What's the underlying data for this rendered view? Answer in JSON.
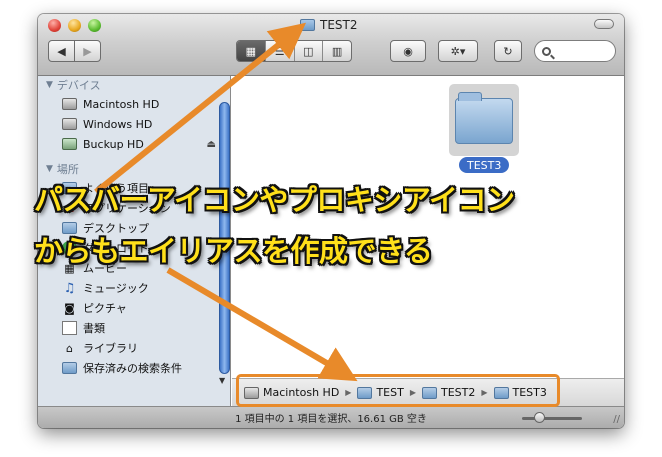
{
  "window": {
    "title": "TEST2"
  },
  "toolbar": {
    "back": "◀",
    "forward": "▶",
    "views": [
      "▦",
      "☰",
      "◫",
      "▥"
    ],
    "eye": "◉",
    "gear": "✲▾",
    "sync": "↻"
  },
  "sidebar": {
    "devices_header": "デバイス",
    "devices": [
      {
        "label": "Macintosh HD",
        "icon": "hard-drive-icon"
      },
      {
        "label": "Windows HD",
        "icon": "hard-drive-icon"
      },
      {
        "label": "Buckup HD",
        "icon": "external-drive-icon",
        "eject": "⏏"
      }
    ],
    "places_header": "場所",
    "places": [
      {
        "label": "よく使う項目",
        "icon": "favorites-folder-icon",
        "glyph": ""
      },
      {
        "label": "アプリケーション",
        "icon": "applications-icon",
        "glyph": "A"
      },
      {
        "label": "デスクトップ",
        "icon": "desktop-icon",
        "glyph": ""
      },
      {
        "label": "ダウンロード",
        "icon": "downloads-icon",
        "glyph": "↓"
      },
      {
        "label": "ムービー",
        "icon": "movies-icon",
        "glyph": "▦"
      },
      {
        "label": "ミュージック",
        "icon": "music-icon",
        "glyph": "♫"
      },
      {
        "label": "ピクチャ",
        "icon": "pictures-icon",
        "glyph": "◙"
      },
      {
        "label": "書類",
        "icon": "documents-icon",
        "glyph": ""
      },
      {
        "label": "ライブラリ",
        "icon": "library-icon",
        "glyph": "⌂"
      },
      {
        "label": "保存済みの検索条件",
        "icon": "smart-folder-icon",
        "glyph": ""
      }
    ]
  },
  "content": {
    "items": [
      {
        "label": "TEST3",
        "selected": true
      }
    ]
  },
  "pathbar": {
    "segments": [
      "Macintosh HD",
      "TEST",
      "TEST2",
      "TEST3"
    ],
    "separator": "▶"
  },
  "status": {
    "text": "1 項目中の 1 項目を選択、16.61 GB 空き",
    "grip": "//"
  },
  "annotation": {
    "line1": "パスバーアイコンやプロキシアイコン",
    "line2": "からもエイリアスを作成できる",
    "color": "#ffe01a",
    "arrow_color": "#e88a2a"
  }
}
